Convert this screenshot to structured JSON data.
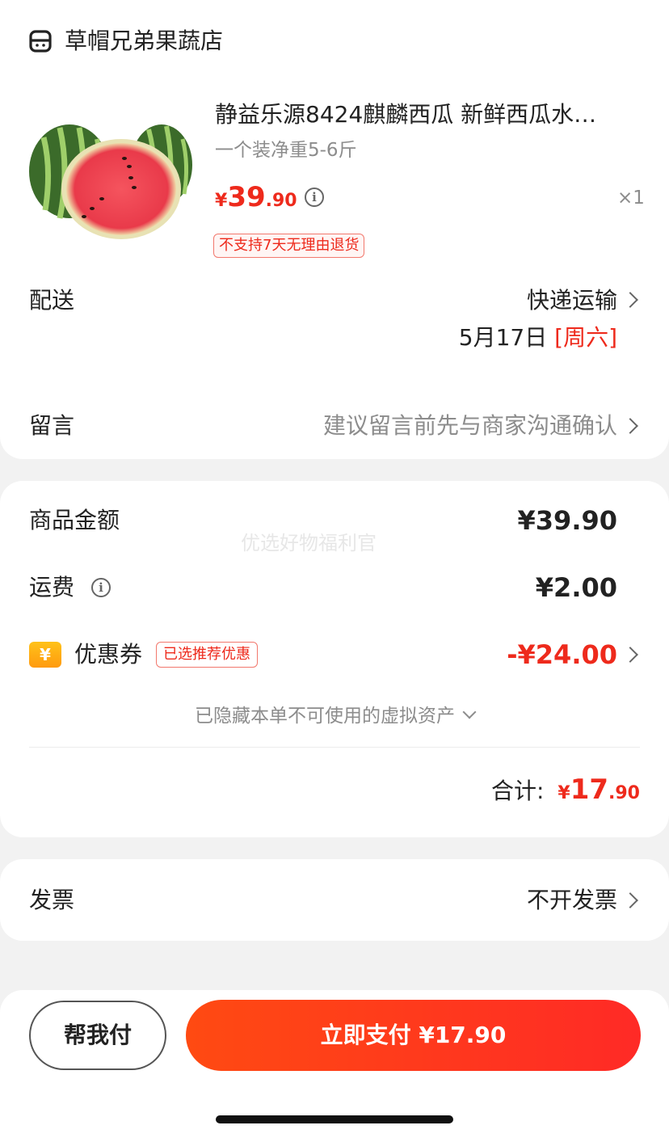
{
  "store": {
    "icon": "store-icon",
    "name": "草帽兄弟果蔬店"
  },
  "product": {
    "title": "静益乐源8424麒麟西瓜 新鲜西瓜水…",
    "spec": "一个装净重5-6斤",
    "price_currency": "¥",
    "price_int": "39",
    "price_dec": ".90",
    "quantity": "×1",
    "no_return_tag": "不支持7天无理由退货"
  },
  "shipping": {
    "label": "配送",
    "method": "快递运输",
    "date": "5月17日 ",
    "weekday": "[周六]"
  },
  "message": {
    "label": "留言",
    "placeholder": "建议留言前先与商家沟通确认"
  },
  "summary": {
    "subtotal_label": "商品金额",
    "subtotal_value": "¥39.90",
    "watermark": "优选好物福利官",
    "shipping_fee_label": "运费",
    "shipping_fee_value": "¥2.00",
    "coupon_label": "优惠券",
    "coupon_icon_text": "¥",
    "coupon_tag": "已选推荐优惠",
    "coupon_value": "-¥24.00",
    "hidden_assets": "已隐藏本单不可使用的虚拟资产",
    "total_label": "合计:",
    "total_currency": "¥",
    "total_int": "17",
    "total_dec": ".90"
  },
  "invoice": {
    "label": "发票",
    "value": "不开发票"
  },
  "actions": {
    "help_pay": "帮我付",
    "pay_now": "立即支付 ¥17.90"
  },
  "colors": {
    "accent": "#ee2a1c",
    "pay_gradient_start": "#ff4a12",
    "pay_gradient_end": "#ff2a26"
  }
}
